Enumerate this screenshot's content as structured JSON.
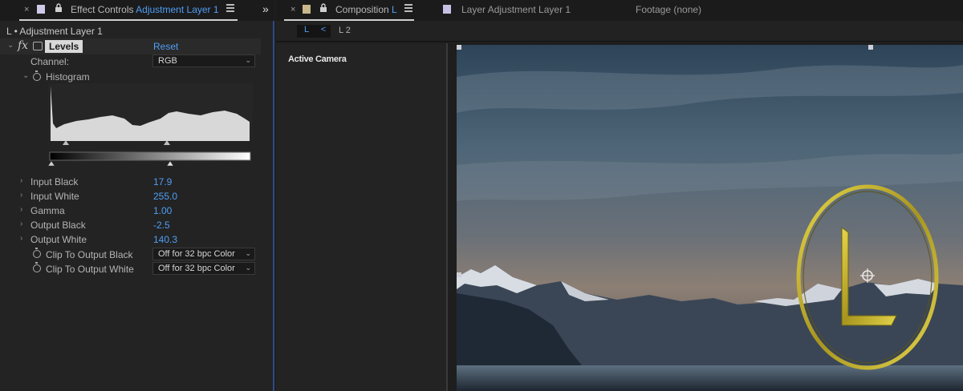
{
  "effect_controls": {
    "tab_prefix": "Effect Controls",
    "tab_layer": "Adjustment Layer 1",
    "panel_expand": "»",
    "layer_header": "L • Adjustment Layer 1",
    "effect": {
      "fx": "fx",
      "name": "Levels",
      "reset": "Reset"
    },
    "channel": {
      "label": "Channel:",
      "value": "RGB"
    },
    "histogram_label": "Histogram",
    "params": [
      {
        "label": "Input Black",
        "value": "17.9"
      },
      {
        "label": "Input White",
        "value": "255.0"
      },
      {
        "label": "Gamma",
        "value": "1.00"
      },
      {
        "label": "Output Black",
        "value": "-2.5"
      },
      {
        "label": "Output White",
        "value": "140.3"
      }
    ],
    "clip_black": {
      "label": "Clip To Output Black",
      "value": "Off for 32 bpc Color"
    },
    "clip_white": {
      "label": "Clip To Output White",
      "value": "Off for 32 bpc Color"
    }
  },
  "composition": {
    "tab_prefix": "Composition",
    "tab_name": "L",
    "layer_tab": "Layer  Adjustment Layer 1",
    "footage_tab": "Footage  (none)",
    "flow_current": "L",
    "flow_chevron": "<",
    "flow_next": "L 2",
    "active_camera": "Active Camera"
  },
  "icons": {
    "close": "×",
    "lock": "🔒",
    "chevron_down": "⌄",
    "chevron_right": "›"
  },
  "colors": {
    "accent_blue": "#4f9ef5",
    "ring_gold": "#c9b52a"
  }
}
